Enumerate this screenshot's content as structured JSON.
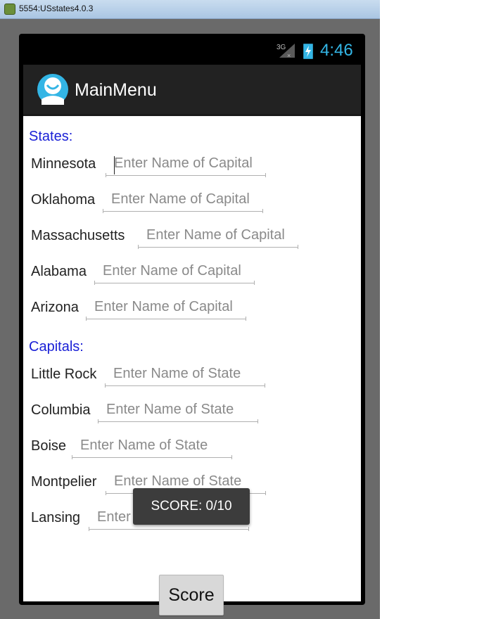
{
  "window": {
    "title": "5554:USstates4.0.3"
  },
  "status_bar": {
    "network": "3G",
    "time": "4:46"
  },
  "app": {
    "title": "MainMenu"
  },
  "states_section": {
    "header": "States:",
    "rows": [
      {
        "label": "Minnesota",
        "placeholder": "Enter Name of Capital"
      },
      {
        "label": "Oklahoma",
        "placeholder": "Enter Name of Capital"
      },
      {
        "label": "Massachusetts",
        "placeholder": "Enter Name of Capital"
      },
      {
        "label": "Alabama",
        "placeholder": "Enter Name of Capital"
      },
      {
        "label": "Arizona",
        "placeholder": "Enter Name of Capital"
      }
    ]
  },
  "capitals_section": {
    "header": "Capitals:",
    "rows": [
      {
        "label": "Little Rock",
        "placeholder": "Enter Name of State"
      },
      {
        "label": "Columbia",
        "placeholder": "Enter Name of State"
      },
      {
        "label": "Boise",
        "placeholder": "Enter Name of State"
      },
      {
        "label": "Montpelier",
        "placeholder": "Enter Name of State"
      },
      {
        "label": "Lansing",
        "placeholder": "Enter Name of State"
      }
    ]
  },
  "score_button": {
    "label": "Score"
  },
  "toast": {
    "text": "SCORE: 0/10"
  },
  "colors": {
    "section_header": "#1a20d6",
    "status_accent": "#33b5e5",
    "action_bar": "#222222"
  }
}
